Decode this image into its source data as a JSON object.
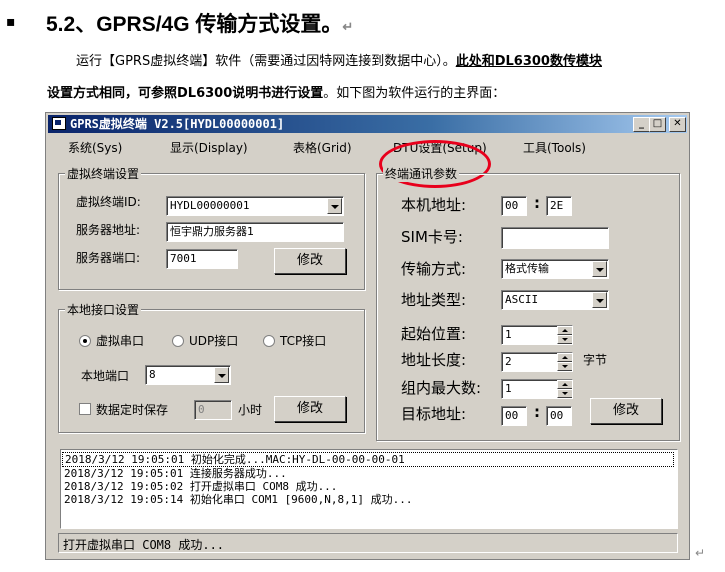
{
  "doc": {
    "bullet": "▪",
    "heading": "5.2、GPRS/4G 传输方式设置。",
    "para1_normal": "运行【GPRS虚拟终端】软件（需要通过因特网连接到数据中心）。",
    "para1_bold_underline": "此处和DL6300数传模块",
    "para2_bold": "设置方式相同，可参照DL6300说明书进行设置",
    "para2_normal": "。如下图为软件运行的主界面：",
    "return_mark": "↵"
  },
  "window": {
    "title": "GPRS虚拟终端  V2.5[HYDL00000001]",
    "controls": {
      "minimize": "_",
      "maximize": "□",
      "close": "✕"
    },
    "menu": [
      "系统(Sys)",
      "显示(Display)",
      "表格(Grid)",
      "DTU设置(Setup)",
      "工具(Tools)"
    ],
    "virtual_terminal": {
      "group_title": "虚拟终端设置",
      "id_label": "虚拟终端ID:",
      "id_value": "HYDL00000001",
      "server_addr_label": "服务器地址:",
      "server_addr_value": "恒宇鼎力服务器1",
      "server_port_label": "服务器端口:",
      "server_port_value": "7001",
      "modify_button": "修改"
    },
    "local_interface": {
      "group_title": "本地接口设置",
      "radio_virtual": "虚拟串口",
      "radio_udp": "UDP接口",
      "radio_tcp": "TCP接口",
      "local_port_label": "本地端口",
      "local_port_value": "8",
      "timed_save_label": "数据定时保存",
      "timed_save_value": "0",
      "hours_label": "小时",
      "modify_button": "修改"
    },
    "terminal_comm": {
      "group_title": "终端通讯参数",
      "local_addr_label": "本机地址:",
      "local_addr_1": "00",
      "local_addr_2": "2E",
      "colon": ":",
      "sim_label": "SIM卡号:",
      "sim_value": "",
      "transfer_mode_label": "传输方式:",
      "transfer_mode_value": "格式传输",
      "addr_type_label": "地址类型:",
      "addr_type_value": "ASCII",
      "start_pos_label": "起始位置:",
      "start_pos_value": "1",
      "addr_len_label": "地址长度:",
      "addr_len_value": "2",
      "byte_unit": "字节",
      "group_max_label": "组内最大数:",
      "group_max_value": "1",
      "target_addr_label": "目标地址:",
      "target_addr_1": "00",
      "target_addr_2": "00",
      "modify_button": "修改"
    },
    "log": [
      "2018/3/12 19:05:01 初始化完成...MAC:HY-DL-00-00-00-01",
      "2018/3/12 19:05:01 连接服务器成功...",
      "2018/3/12 19:05:02 打开虚拟串口 COM8 成功...",
      "2018/3/12 19:05:14 初始化串口 COM1 [9600,N,8,1] 成功..."
    ],
    "status": "打开虚拟串口 COM8 成功..."
  },
  "colors": {
    "highlight_ring": "#e8001c",
    "title_bar": "#0a246a",
    "window_face": "#d4d0c8"
  }
}
